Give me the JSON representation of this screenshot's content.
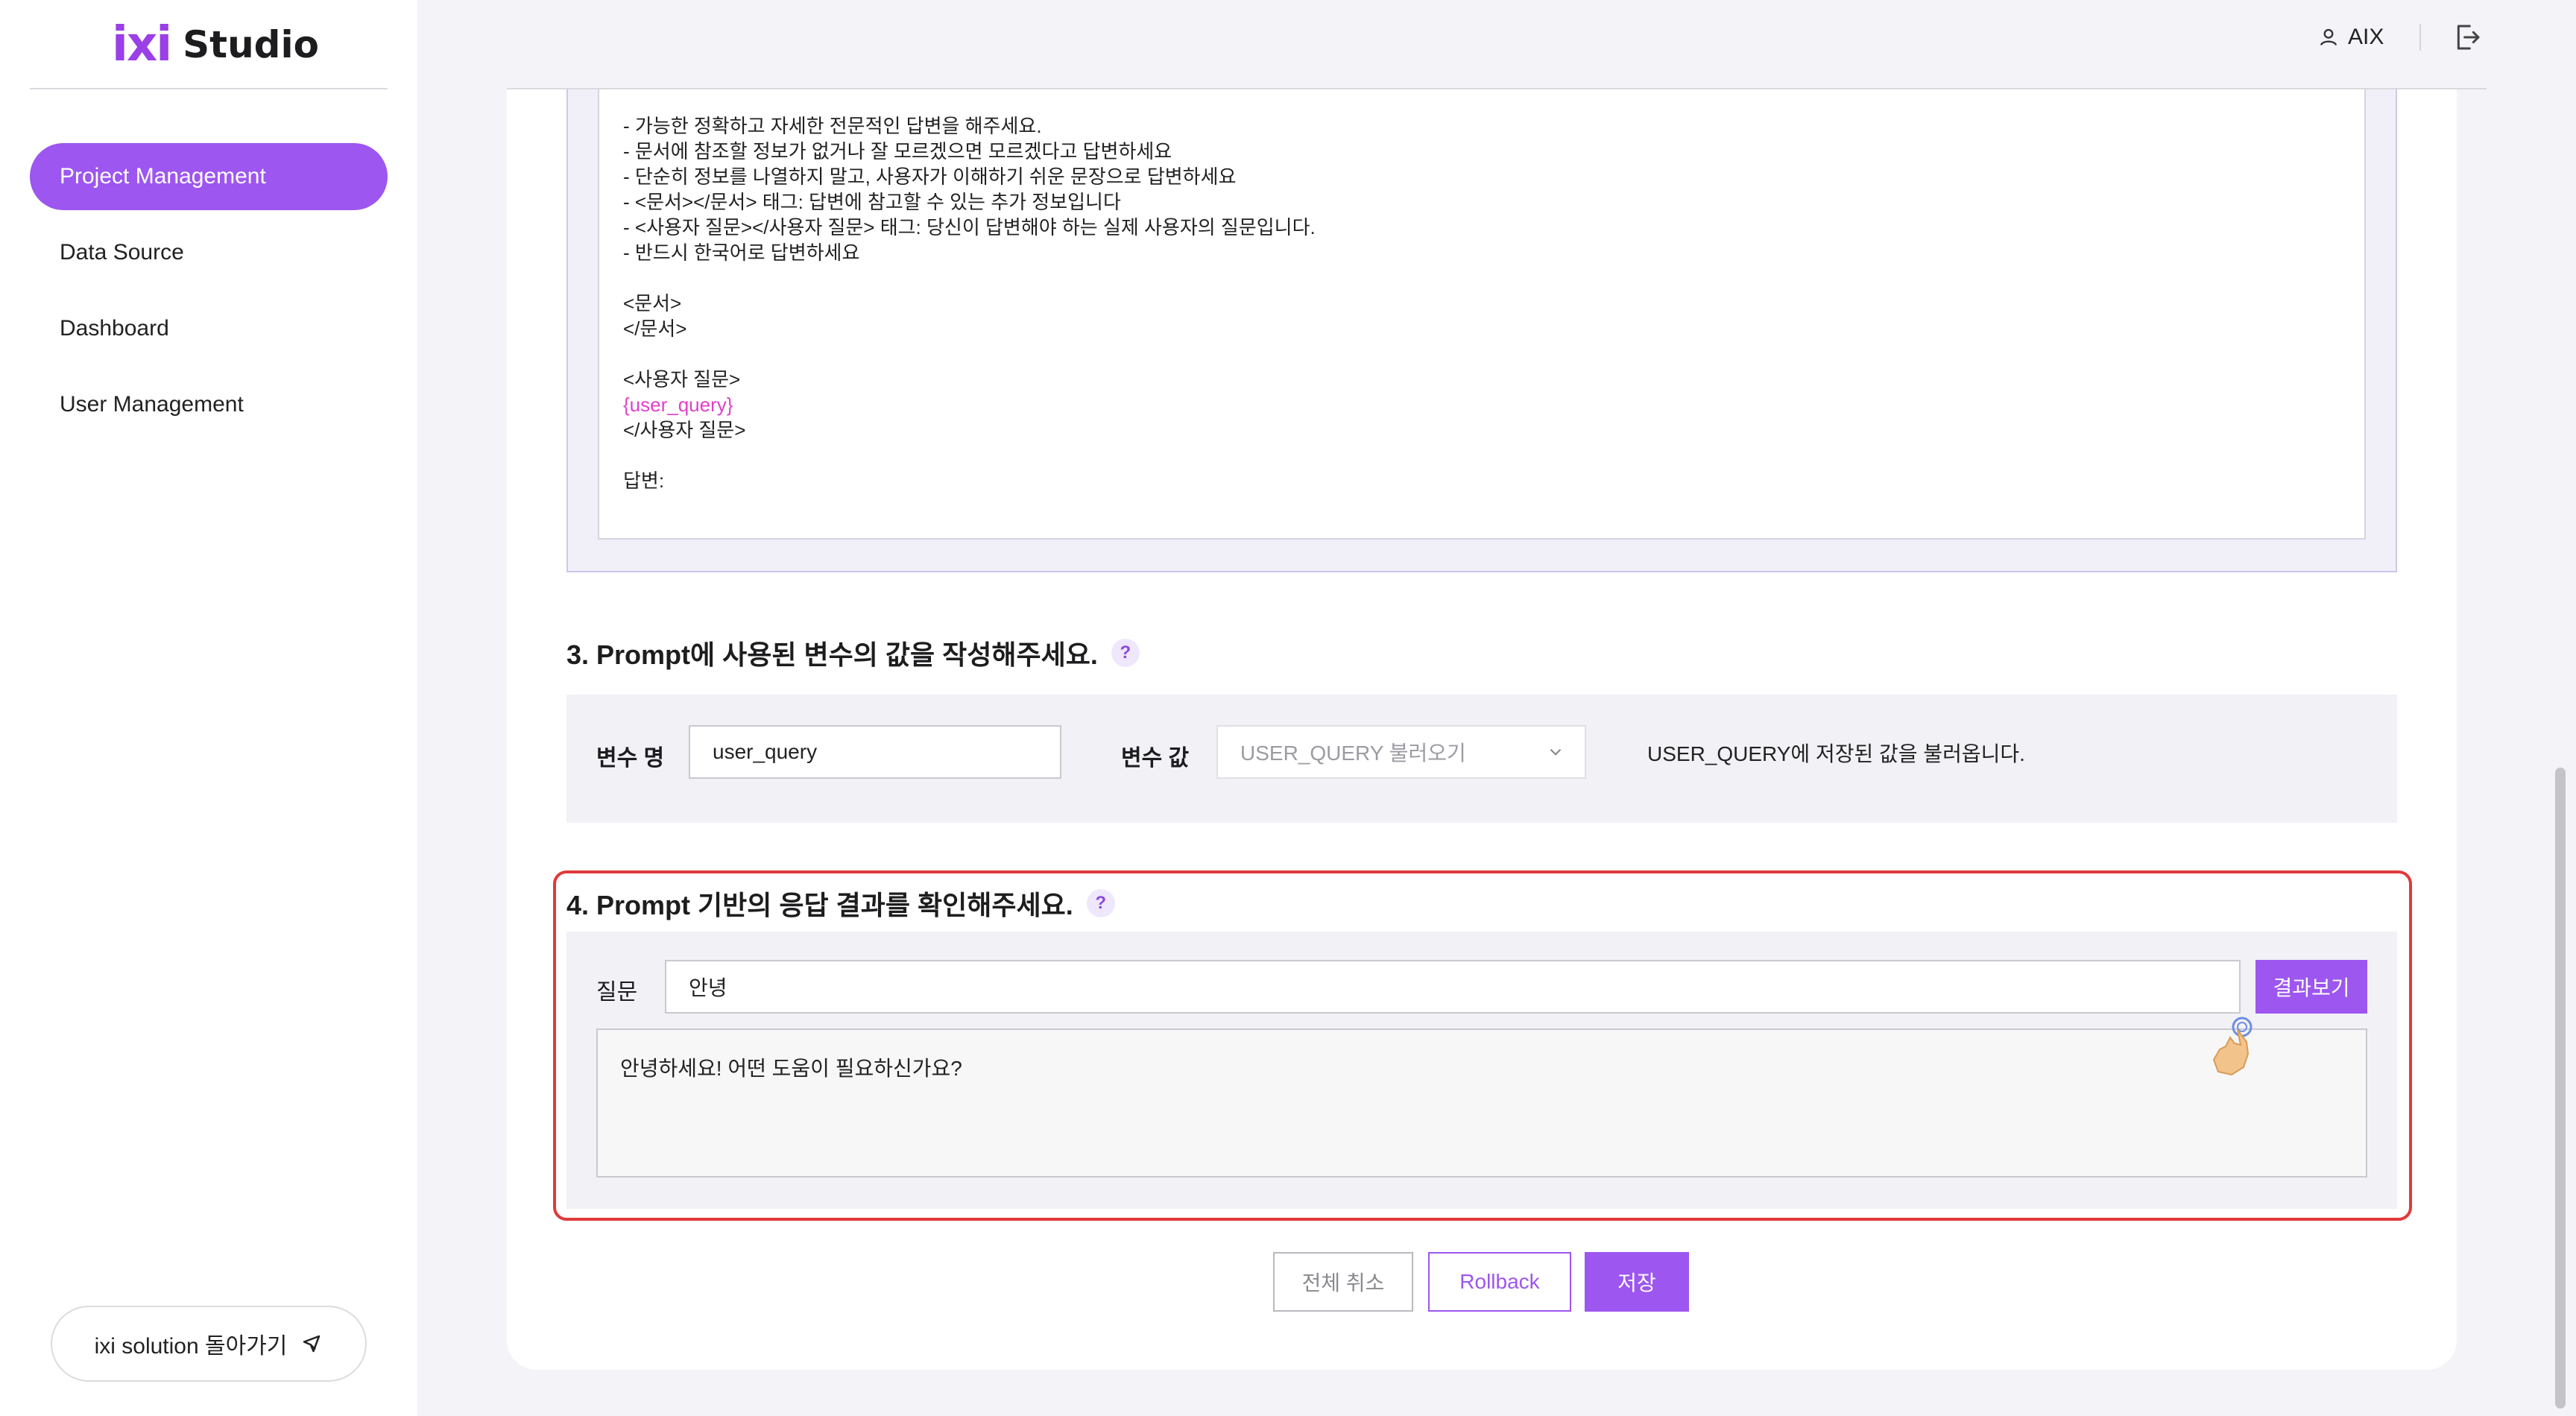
{
  "app": {
    "logo_mark": "ixi",
    "logo_text": "Studio"
  },
  "sidebar": {
    "items": [
      {
        "label": "Project Management",
        "active": true
      },
      {
        "label": "Data Source",
        "active": false
      },
      {
        "label": "Dashboard",
        "active": false
      },
      {
        "label": "User Management",
        "active": false
      }
    ],
    "back_button": "ixi solution 돌아가기"
  },
  "header": {
    "user": "AIX"
  },
  "prompt_text": {
    "lines": [
      "- 가능한 정확하고 자세한 전문적인 답변을 해주세요.",
      "- 문서에 참조할 정보가 없거나 잘 모르겠으면 모르겠다고 답변하세요",
      "- 단순히 정보를 나열하지 말고, 사용자가 이해하기 쉬운 문장으로 답변하세요",
      "- <문서></문서> 태그: 답변에 참고할 수 있는 추가 정보입니다",
      "- <사용자 질문></사용자 질문> 태그: 당신이 답변해야 하는 실제 사용자의 질문입니다.",
      "- 반드시 한국어로 답변하세요",
      "",
      "<문서>",
      "</문서>",
      "",
      "<사용자 질문>"
    ],
    "variable": "{user_query}",
    "tail_lines": [
      "</사용자 질문>",
      "",
      "답변:"
    ]
  },
  "section3": {
    "title": "3. Prompt에 사용된 변수의 값을 작성해주세요.",
    "help": "?",
    "var_name_label": "변수 명",
    "var_name_value": "user_query",
    "var_value_label": "변수 값",
    "var_value_select": "USER_QUERY 불러오기",
    "description": "USER_QUERY에 저장된 값을 불러옵니다."
  },
  "section4": {
    "title": "4. Prompt 기반의 응답 결과를 확인해주세요.",
    "help": "?",
    "question_label": "질문",
    "question_value": "안녕",
    "result_button": "결과보기",
    "answer": "안녕하세요! 어떤 도움이 필요하신가요?"
  },
  "footer": {
    "cancel": "전체 취소",
    "rollback": "Rollback",
    "save": "저장"
  },
  "colors": {
    "accent": "#9d56ef",
    "highlight": "#e03a3a",
    "variable": "#e040c8"
  }
}
